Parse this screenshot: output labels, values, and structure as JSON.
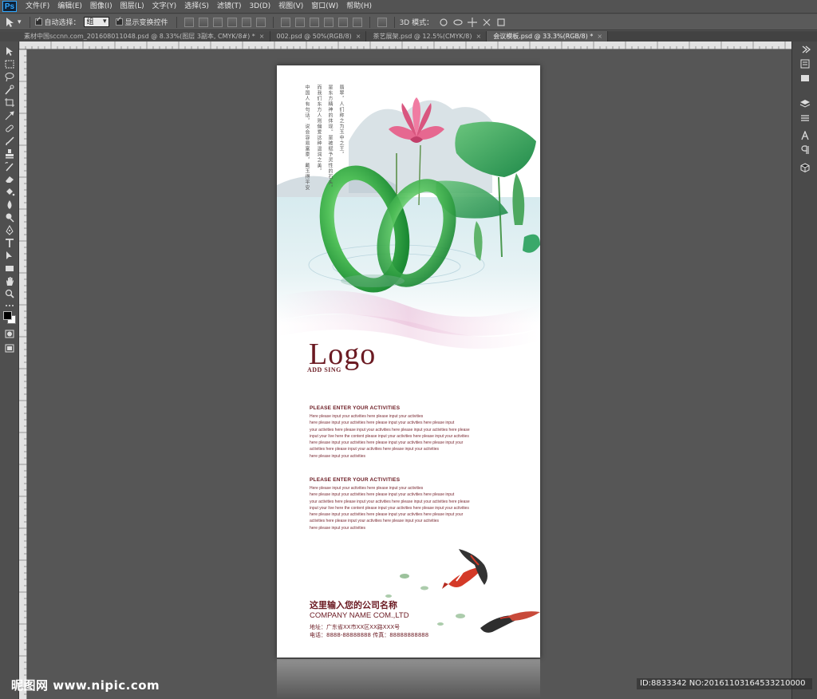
{
  "app": {
    "logo": "Ps"
  },
  "menu": [
    "文件(F)",
    "编辑(E)",
    "图像(I)",
    "图层(L)",
    "文字(Y)",
    "选择(S)",
    "滤镜(T)",
    "3D(D)",
    "视图(V)",
    "窗口(W)",
    "帮助(H)"
  ],
  "options": {
    "auto_select_label": "自动选择：",
    "auto_select_value": "组",
    "show_transform_label": "显示变换控件",
    "mode_3d_label": "3D 模式："
  },
  "tabs": [
    {
      "label": "素材中国sccnn.com_20160801104​8.psd @ 8.33%(图层 3副本, CMYK/8#) *"
    },
    {
      "label": "002.psd @ 50%(RGB/8)"
    },
    {
      "label": "茶艺展架.psd @ 12.5%(CMYK/8)"
    },
    {
      "label": "会议模板.psd @ 33.3%(RGB/8) *"
    }
  ],
  "poster": {
    "poem_col1": "翡翠，人们称之为玉中之王，",
    "poem_col2": "是东方精神的体现。是被赋予灵性的石头，",
    "poem_col3": "而我们东方人则偏爱这种温润之美，",
    "poem_col4": "中国人有句话，说会容易富豪，戴玉得平安",
    "logo": "Logo",
    "logo_sub": "ADD SING",
    "activities": [
      {
        "heading": "PLEASE ENTER YOUR ACTIVITIES",
        "lines": [
          "Here please input your activities here please input your activities",
          "here please input your activities here please input your activities here please input",
          "your activities here please input your activities here please input your activities here please",
          "input your live here the content please input your activities here please input your activities",
          "here please input your activities here please input your activities here please input your",
          " activities here please input your activities here please input your activities",
          "here please input your activities"
        ]
      },
      {
        "heading": "PLEASE ENTER YOUR ACTIVITIES",
        "lines": [
          "Here please input your activities here please input your activities",
          "here please input your activities here please input your activities here please input",
          "your activities here please input your activities here please input your activities here please",
          "input your live here the content please input your activities here please input your activities",
          "here please input your activities here please input your activities here please input your",
          " activities here please input your activities here please input your activities",
          "here please input your activities"
        ]
      }
    ],
    "company_cn": "这里输入您的公司名称",
    "company_en": "COMPANY NAME COM.,LTD",
    "address": "地址：广东省XX市XX区XX路XXX号",
    "phone": "电话：8888-88888888  传真：88888888888"
  },
  "watermark": {
    "left": "昵图网 www.nipic.com",
    "right": "ID:8833342 NO:20161103164533210000"
  },
  "colors": {
    "accent": "#6b1a22",
    "jade": "#3fae4a",
    "lotus": "#e0507a"
  }
}
